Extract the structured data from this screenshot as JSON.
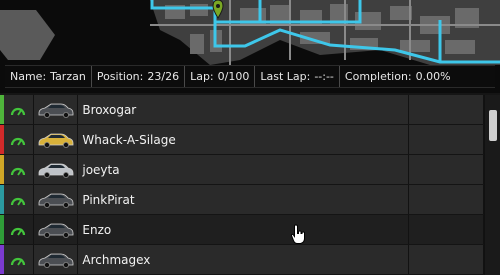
{
  "status": {
    "name_label": "Name:",
    "name_value": "Tarzan",
    "position_label": "Position:",
    "position_value": "23/26",
    "lap_label": "Lap:",
    "lap_value": "0/100",
    "lastlap_label": "Last Lap:",
    "lastlap_value": "--:--",
    "completion_label": "Completion:",
    "completion_value": "0.00%"
  },
  "racers": [
    {
      "name": "Broxogar",
      "color": "#4fb43b",
      "car": "dark-car-icon"
    },
    {
      "name": "Whack-A-Silage",
      "color": "#d12a2a",
      "car": "yellow-car-icon"
    },
    {
      "name": "joeyta",
      "color": "#cfa626",
      "car": "silver-car-icon"
    },
    {
      "name": "PinkPirat",
      "color": "#2b9aa0",
      "car": "dark-car-icon"
    },
    {
      "name": "Enzo",
      "color": "#2f9c38",
      "car": "dark-car-icon"
    },
    {
      "name": "Archmagex",
      "color": "#7c3bd0",
      "car": "dark-car-icon"
    }
  ]
}
